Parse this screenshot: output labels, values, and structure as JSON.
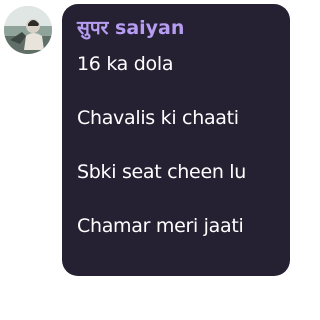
{
  "message": {
    "avatar_icon": "user-avatar-photo",
    "sender_name": "सुपर saiyan",
    "lines": [
      "16 ka dola",
      "Chavalis ki chaati",
      "Sbki seat cheen lu",
      "Chamar meri jaati"
    ]
  },
  "colors": {
    "bubble_background": "#262033",
    "sender_name": "#b69df2",
    "message_text": "#ffffff"
  }
}
